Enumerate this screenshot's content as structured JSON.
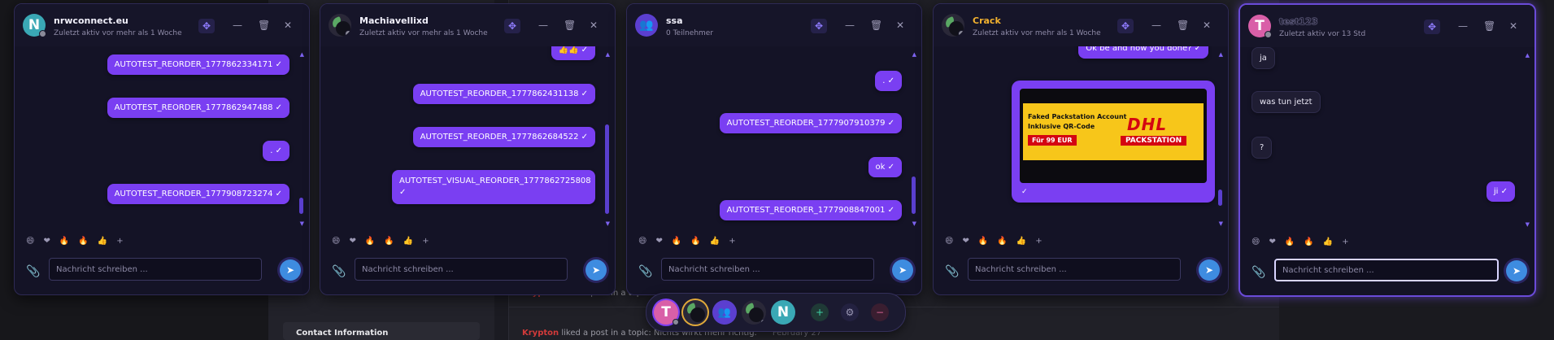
{
  "background": {
    "contact_heading": "Contact Information",
    "feed": [
      {
        "user": "Krypton",
        "text": "liked a post in a topic:",
        "date": ""
      },
      {
        "user": "Krypton",
        "text": "liked a post in a topic: Nichts wirkt mehr richtig.",
        "date": "February 27"
      }
    ]
  },
  "emoji_reactions": [
    "😄",
    "❤",
    "🔥",
    "🔥",
    "👍",
    "+"
  ],
  "composer": {
    "placeholder": "Nachricht schreiben ...",
    "send_icon": "send-icon",
    "attach_icon": "paperclip-icon"
  },
  "chats": [
    {
      "initial": "N",
      "avatar_color": "#3aa8b5",
      "name": "nrwconnect.eu",
      "status": "Zuletzt aktiv vor mehr als 1 Woche",
      "messages": [
        "AUTOTEST_REORDER_1777862334171 ✓",
        "AUTOTEST_REORDER_1777862947488 ✓",
        ". ✓",
        "AUTOTEST_REORDER_1777908723274 ✓"
      ]
    },
    {
      "initial": "",
      "avatar_color": "#2a2838",
      "name": "Machiavellixd",
      "status": "Zuletzt aktiv vor mehr als 1 Woche",
      "messages": [
        "👍👍 ✓",
        "AUTOTEST_REORDER_1777862431138 ✓",
        "AUTOTEST_REORDER_1777862684522 ✓",
        "AUTOTEST_VISUAL_REORDER_1777862725808 ✓"
      ]
    },
    {
      "initial": "",
      "avatar_color": "#5b3fd0",
      "name": "ssa",
      "status": "0 Teilnehmer",
      "messages": [
        ". ✓",
        "AUTOTEST_REORDER_1777907910379 ✓",
        "ok ✓",
        "AUTOTEST_REORDER_1777908847001 ✓"
      ]
    },
    {
      "initial": "",
      "avatar_color": "#2a2838",
      "name": "Crack",
      "status": "Zuletzt aktiv vor mehr als 1 Woche",
      "messages": [
        "Ok be and how you done? ✓"
      ],
      "image": {
        "line1": "Faked Packstation Account",
        "line2": "Inklusive QR-Code",
        "price": "Für 99 EUR",
        "logo": "DHL",
        "logo_sub": "PACKSTATION",
        "check": "✓"
      }
    },
    {
      "initial": "T",
      "avatar_color": "#d95fa8",
      "name": "test123",
      "status": "Zuletzt aktiv vor 13 Std",
      "messages_in": [
        "ja",
        "was tun jetzt",
        "?"
      ],
      "messages": [
        "ji ✓"
      ]
    }
  ],
  "dock": {
    "avatars": [
      {
        "initial": "T",
        "color": "#d95fa8"
      },
      {
        "initial": "",
        "color": "#2a2838"
      },
      {
        "initial": "",
        "color": "#5b3fd0"
      },
      {
        "initial": "",
        "color": "#2a2838"
      },
      {
        "initial": "N",
        "color": "#3aa8b5"
      }
    ],
    "add_icon": "plus-icon",
    "settings_icon": "gear-icon",
    "minimize_icon": "minus-icon",
    "add_label": "+",
    "settings_label": "⚙",
    "minimize_label": "−"
  },
  "colors": {
    "accent": "#7a3ff2",
    "send": "#3e8ce0",
    "window_bg": "#141326",
    "orange_name": "#f3b22f"
  }
}
